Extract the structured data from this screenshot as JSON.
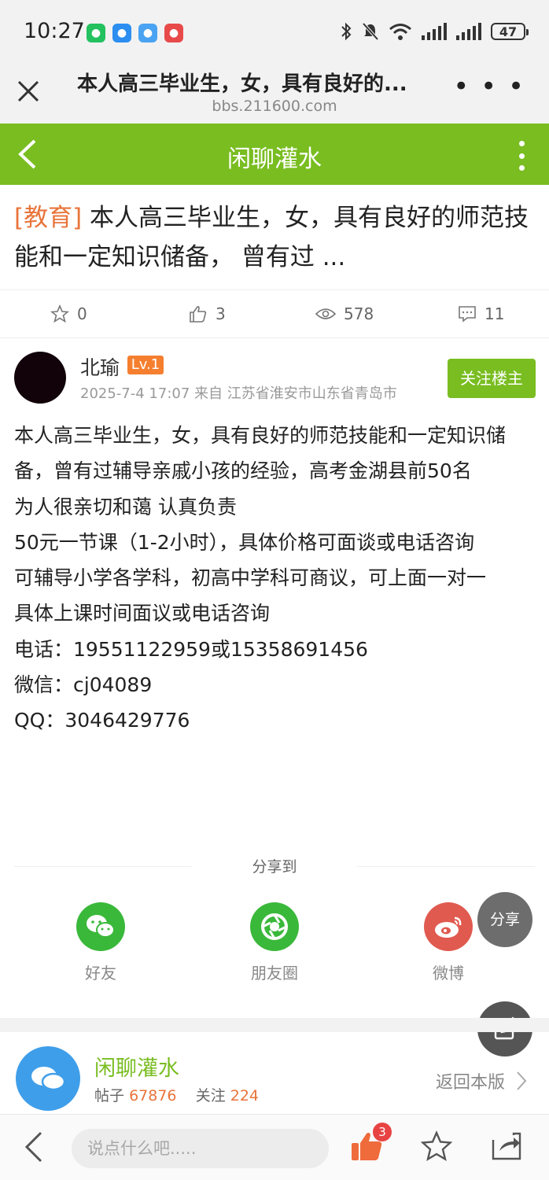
{
  "status_bar": {
    "time": "10:27",
    "battery": "47"
  },
  "browser": {
    "title": "本人高三毕业生，女，具有良好的...",
    "url": "bbs.211600.com"
  },
  "forum_header": {
    "title": "闲聊灌水"
  },
  "post": {
    "tag": "[教育]",
    "title": " 本人高三毕业生，女，具有良好的师范技能和一定知识储备， 曾有过 ...",
    "stats": {
      "favorites": "0",
      "likes": "3",
      "views": "578",
      "comments": "11"
    },
    "author": {
      "name": "北瑜",
      "level": "Lv.1"
    },
    "meta": "2025-7-4 17:07 来自 江苏省淮安市山东省青岛市",
    "follow_label": "关注楼主",
    "body_lines": [
      "本人高三毕业生，女，具有良好的师范技能和一定知识储备，曾有过辅导亲戚小孩的经验，高考金湖县前50名",
      "为人很亲切和蔼 认真负责",
      "50元一节课（1-2小时），具体价格可面谈或电话咨询",
      "可辅导小学各学科，初高中学科可商议，可上面一对一",
      "具体上课时间面议或电话咨询",
      "电话：19551122959或15358691456",
      "微信：cj04089",
      "QQ：3046429776"
    ]
  },
  "share": {
    "label": "分享到",
    "items": [
      {
        "label": "好友",
        "icon": "wechat-icon",
        "color": "#3ab83a"
      },
      {
        "label": "朋友圈",
        "icon": "moments-icon",
        "color": "#3ab83a"
      },
      {
        "label": "微博",
        "icon": "weibo-icon",
        "color": "#e05a4f"
      }
    ],
    "float_label": "分享"
  },
  "forum_card": {
    "name": "闲聊灌水",
    "posts_label": "帖子",
    "posts": "67876",
    "follows_label": "关注",
    "follows": "224",
    "back_label": "返回本版"
  },
  "bottom_bar": {
    "placeholder": "说点什么吧.....",
    "like_count": "3"
  },
  "colors": {
    "brand_green": "#79bd21",
    "accent_orange": "#e8743b",
    "level_badge": "#f57f2f"
  }
}
